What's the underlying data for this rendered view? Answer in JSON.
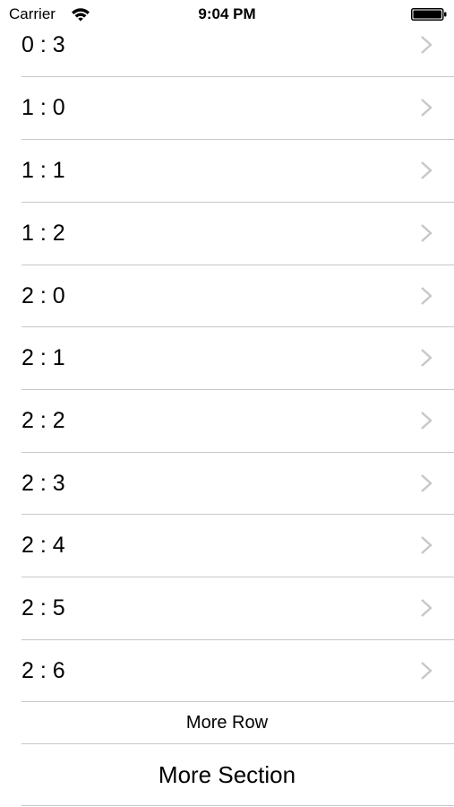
{
  "status_bar": {
    "carrier": "Carrier",
    "time": "9:04 PM",
    "wifi_icon": "wifi-icon",
    "battery_icon": "battery-full-icon",
    "battery_level": 1.0
  },
  "list": {
    "rows": [
      {
        "label": "0 : 3",
        "accessory": "chevron-right-icon"
      },
      {
        "label": "1 : 0",
        "accessory": "chevron-right-icon"
      },
      {
        "label": "1 : 1",
        "accessory": "chevron-right-icon"
      },
      {
        "label": "1 : 2",
        "accessory": "chevron-right-icon"
      },
      {
        "label": "2 : 0",
        "accessory": "chevron-right-icon"
      },
      {
        "label": "2 : 1",
        "accessory": "chevron-right-icon"
      },
      {
        "label": "2 : 2",
        "accessory": "chevron-right-icon"
      },
      {
        "label": "2 : 3",
        "accessory": "chevron-right-icon"
      },
      {
        "label": "2 : 4",
        "accessory": "chevron-right-icon"
      },
      {
        "label": "2 : 5",
        "accessory": "chevron-right-icon"
      },
      {
        "label": "2 : 6",
        "accessory": "chevron-right-icon"
      }
    ],
    "more_row_label": "More Row",
    "more_section_label": "More Section"
  },
  "colors": {
    "separator": "#c8c7cc",
    "chevron": "#c7c7cc",
    "text": "#000000",
    "background": "#ffffff"
  }
}
